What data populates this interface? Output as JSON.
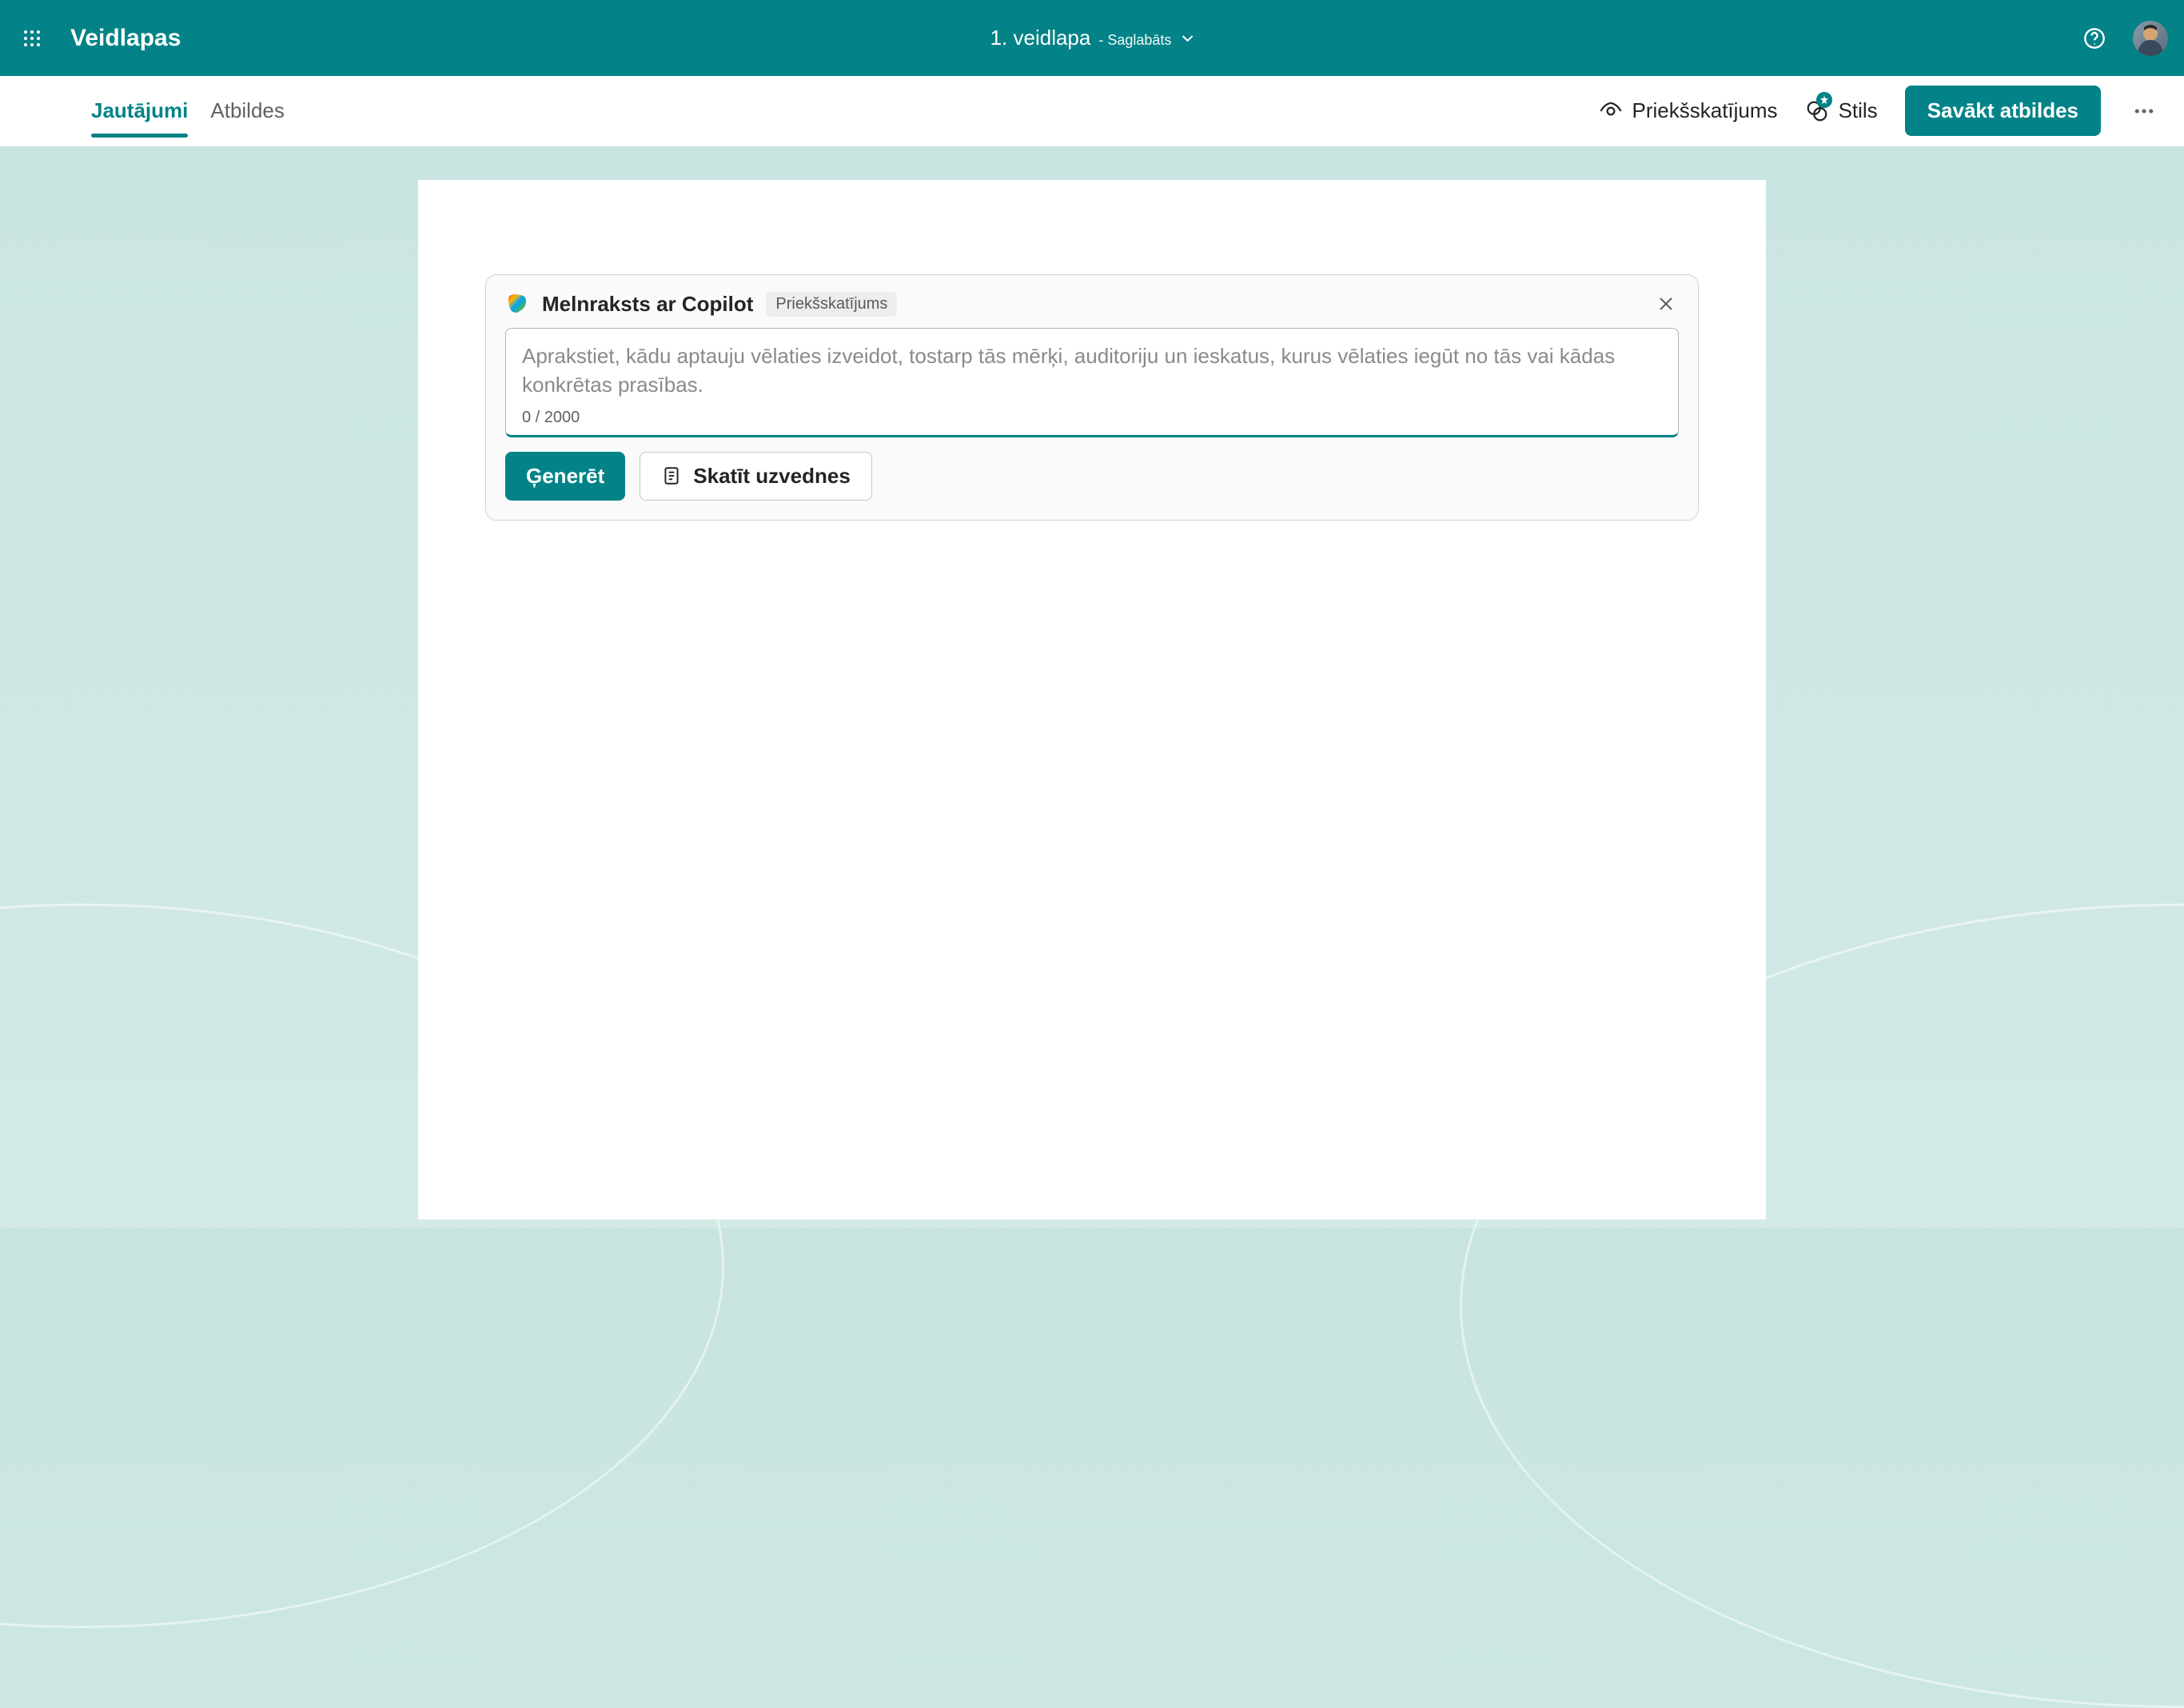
{
  "header": {
    "app_name": "Veidlapas",
    "form_title": "1. veidlapa",
    "save_status": "- Saglabāts"
  },
  "toolbar": {
    "tabs": {
      "questions": "Jautājumi",
      "responses": "Atbildes"
    },
    "preview": "Priekšskatījums",
    "style": "Stils",
    "collect": "Savākt atbildes"
  },
  "copilot": {
    "title": "Melnraksts ar Copilot",
    "badge": "Priekšskatījums",
    "placeholder": "Aprakstiet, kādu aptauju vēlaties izveidot, tostarp tās mērķi, auditoriju un ieskatus, kurus vēlaties iegūt no tās vai kādas konkrētas prasības.",
    "char_count": "0 / 2000",
    "generate": "Ģenerēt",
    "view_prompts": "Skatīt uzvednes"
  }
}
